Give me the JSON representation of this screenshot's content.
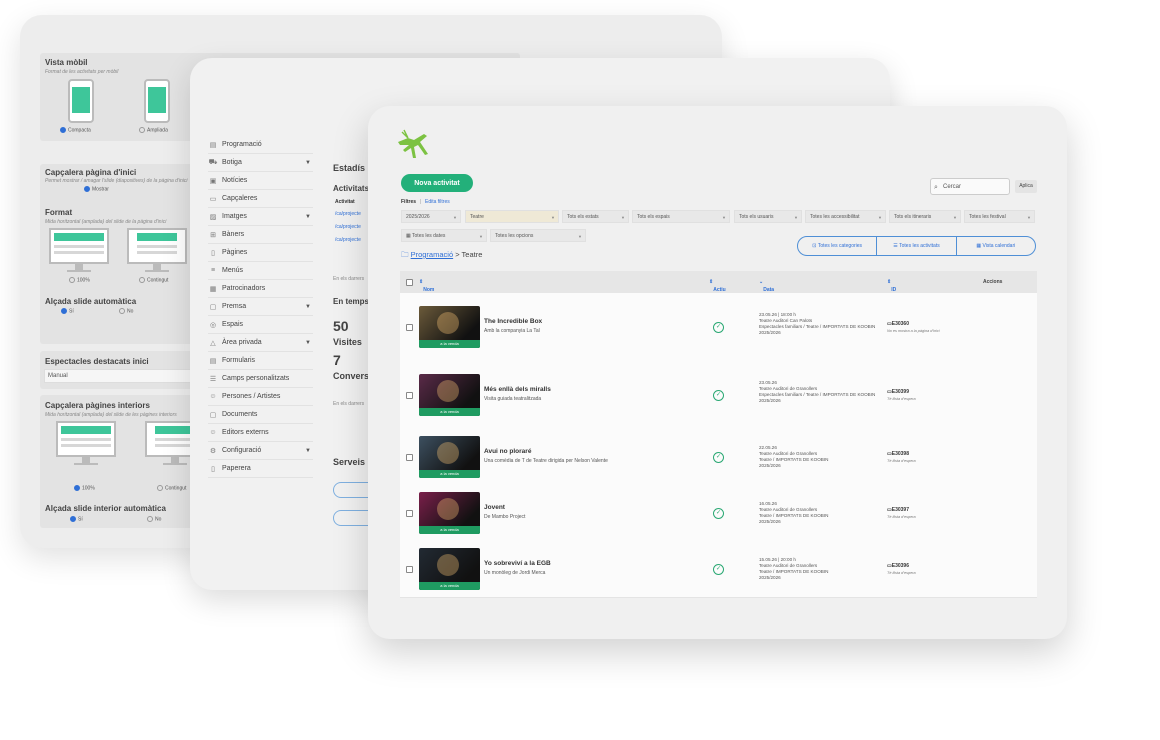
{
  "settings_window": {
    "vista_mobil": {
      "title": "Vista mòbil",
      "subtitle": "Format de les activitats per mòbil",
      "option_compacta": "Compacta",
      "option_ampliada": "Ampliada"
    },
    "capcalera_inici": {
      "title": "Capçalera pàgina d'inici",
      "subtitle": "Permet mostrar / amagar l'slide (diapositives) de la pàgina d'inici",
      "option_mostrar": "Mostrar"
    },
    "format": {
      "title": "Format",
      "subtitle": "Mida horitzontal (amplada) del slide de la pàgina d'inici",
      "option_100": "100%",
      "option_contingut": "Contingut"
    },
    "alcada_slide": {
      "title": "Alçada slide automàtica",
      "option_si": "Sí",
      "option_no": "No"
    },
    "espectacles": {
      "title": "Espectacles destacats inici",
      "value": "Manual"
    },
    "capcalera_interiors": {
      "title": "Capçalera pàgines interiors",
      "subtitle": "Mida horitzontal (amplada) del slide de les pàgines interiors",
      "option_100": "100%",
      "option_contingut": "Contingut"
    },
    "alcada_interior": {
      "title": "Alçada slide interior automàtica",
      "option_si": "Sí",
      "option_no": "No"
    }
  },
  "stats_window": {
    "nav": [
      {
        "label": "Programació",
        "icon": "calendar-icon",
        "glyph": "▤",
        "caret": ""
      },
      {
        "label": "Botiga",
        "icon": "cart-icon",
        "glyph": "⛟",
        "caret": "▼"
      },
      {
        "label": "Notícies",
        "icon": "news-icon",
        "glyph": "▣",
        "caret": ""
      },
      {
        "label": "Capçaleres",
        "icon": "header-icon",
        "glyph": "▭",
        "caret": ""
      },
      {
        "label": "Imatges",
        "icon": "image-icon",
        "glyph": "▨",
        "caret": "▼"
      },
      {
        "label": "Bàners",
        "icon": "banner-icon",
        "glyph": "⊞",
        "caret": ""
      },
      {
        "label": "Pàgines",
        "icon": "page-icon",
        "glyph": "▯",
        "caret": ""
      },
      {
        "label": "Menús",
        "icon": "menu-icon",
        "glyph": "≡",
        "caret": ""
      },
      {
        "label": "Patrocinadors",
        "icon": "sponsor-icon",
        "glyph": "▦",
        "caret": ""
      },
      {
        "label": "Premsa",
        "icon": "folder-icon",
        "glyph": "▢",
        "caret": "▼"
      },
      {
        "label": "Espais",
        "icon": "location-icon",
        "glyph": "◎",
        "caret": ""
      },
      {
        "label": "Àrea privada",
        "icon": "lock-icon",
        "glyph": "△",
        "caret": "▼"
      },
      {
        "label": "Formularis",
        "icon": "form-icon",
        "glyph": "▤",
        "caret": ""
      },
      {
        "label": "Camps personalitzats",
        "icon": "list-icon",
        "glyph": "☰",
        "caret": ""
      },
      {
        "label": "Persones / Artistes",
        "icon": "people-icon",
        "glyph": "☺",
        "caret": ""
      },
      {
        "label": "Documents",
        "icon": "document-icon",
        "glyph": "▢",
        "caret": ""
      },
      {
        "label": "Editors externs",
        "icon": "editors-icon",
        "glyph": "☺",
        "caret": ""
      },
      {
        "label": "Configuració",
        "icon": "gear-icon",
        "glyph": "⚙",
        "caret": "▼"
      },
      {
        "label": "Paperera",
        "icon": "trash-icon",
        "glyph": "▯",
        "caret": ""
      }
    ],
    "heading": "Estadís",
    "activitats_label": "Activitats",
    "activitat_col": "Activitat",
    "links": [
      "/ca/projecte",
      "/ca/projecte",
      "/ca/projecte"
    ],
    "last_note_1": "En els darrers",
    "temps_label": "En temps",
    "visites_value": "50",
    "visites_label": "Visites",
    "conversions_value": "7",
    "conversions_label": "Convers",
    "last_note_2": "En els darrers",
    "serveis_label": "Serveis"
  },
  "main": {
    "new_button": "Nova activitat",
    "search_placeholder": "Cercar",
    "apply_button": "Aplica",
    "filters_label": "Filtres",
    "filters_sep": "|",
    "edit_filters": "Edita filtres",
    "filters_row1": [
      "2025/2026",
      "Teatre",
      "Tots els estats",
      "Tots els espais",
      "Tots els usuaris",
      "Totes les accessibilitat",
      "Tots els itineraris",
      "Totes les festival"
    ],
    "filters_row2": [
      "Totes les dates",
      "Totes les opcions"
    ],
    "breadcrumb_link": "Programació",
    "breadcrumb_current": "> Teatre",
    "view_toggle": [
      "Totes les categories",
      "Totes les activitats",
      "Vista calendari"
    ],
    "columns": {
      "name": "Nom",
      "active": "Actiu",
      "date": "Data",
      "id": "ID",
      "actions": "Accions"
    },
    "rows": [
      {
        "title": "The Incredible Box",
        "subtitle": "Amb la companyia La Tal",
        "badge": "a la venda",
        "date_lines": [
          "23.05.26 | 18:00 h",
          "Teatre Auditori Can Palots",
          "Espectacles familiars / Teatre / IMPORTATS DE KOOBIN",
          "2025/2026"
        ],
        "id": "E30360",
        "id_note": "No es mostra a la pàgina d'inici",
        "bg": "#6b5a3a"
      },
      {
        "title": "Més enllà dels miralls",
        "subtitle": "Visita guiada teatralitzada",
        "badge": "a la venda",
        "date_lines": [
          "23.05.26",
          "Teatre Auditori de Granollers",
          "Espectacles familiars / Teatre / IMPORTATS DE KOOBIN",
          "2025/2026"
        ],
        "id": "E30399",
        "id_note": "Té llista d'espera",
        "bg": "#5a2a48"
      },
      {
        "title": "Avui no ploraré",
        "subtitle": "Una comèdia de T de Teatre dirigida per Nelson Valente",
        "badge": "a la venda",
        "date_lines": [
          "22.05.26",
          "Teatre Auditori de Granollers",
          "Teatre / IMPORTATS DE KOOBIN",
          "2025/2026"
        ],
        "id": "E30398",
        "id_note": "Té llista d'espera",
        "bg": "#3d5060"
      },
      {
        "title": "Jovent",
        "subtitle": "De Mambo Project",
        "badge": "a la venda",
        "date_lines": [
          "16.05.26",
          "Teatre Auditori de Granollers",
          "Teatre / IMPORTATS DE KOOBIN",
          "2025/2026"
        ],
        "id": "E30397",
        "id_note": "Té llista d'espera",
        "bg": "#7a1f4a"
      },
      {
        "title": "Yo sobreviví a la EGB",
        "subtitle": "Un monòleg de Jordi Merca",
        "badge": "a la venda",
        "date_lines": [
          "15.05.26 | 20:00 h",
          "Teatre Auditori de Granollers",
          "Teatre / IMPORTATS DE KOOBIN",
          "2025/2026"
        ],
        "id": "E30396",
        "id_note": "Té llista d'espera",
        "bg": "#222a33"
      }
    ]
  },
  "colors": {
    "accent": "#23b07a",
    "link": "#2f6fd6",
    "preview_green": "#3ec69a"
  }
}
